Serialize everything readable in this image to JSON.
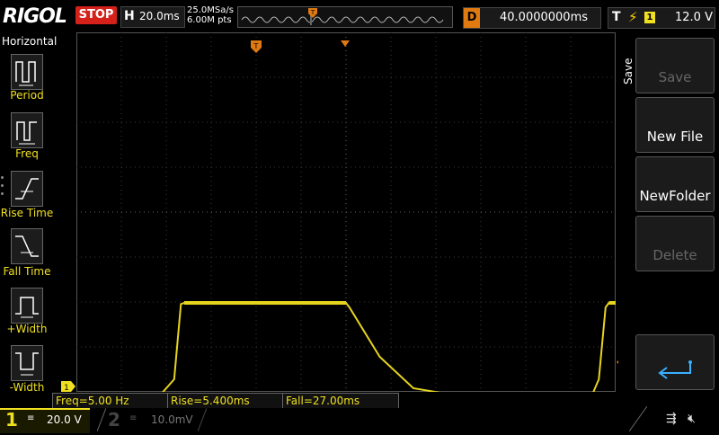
{
  "header": {
    "logo": "RIGOL",
    "run_state": "STOP",
    "timebase_label": "H",
    "timebase": "20.0ms",
    "sample_rate": "25.0MSa/s",
    "memory_depth": "6.00M pts",
    "delay_label": "D",
    "delay": "40.0000000ms",
    "trigger_label": "T",
    "trigger_source": "1",
    "trigger_level": "12.0 V"
  },
  "left_menu": {
    "title": "Horizontal",
    "items": [
      {
        "label": "Period",
        "icon": "period-icon"
      },
      {
        "label": "Freq",
        "icon": "frequency-icon"
      },
      {
        "label": "Rise Time",
        "icon": "rise-time-icon"
      },
      {
        "label": "Fall Time",
        "icon": "fall-time-icon"
      },
      {
        "label": "+Width",
        "icon": "positive-width-icon"
      },
      {
        "label": "-Width",
        "icon": "negative-width-icon"
      }
    ]
  },
  "right_menu": {
    "title": "Save",
    "buttons": [
      {
        "label": "Save",
        "enabled": false
      },
      {
        "label": "New File",
        "enabled": true
      },
      {
        "label": "NewFolder",
        "enabled": true
      },
      {
        "label": "Delete",
        "enabled": false
      },
      {
        "label": "",
        "icon": "return-arrow-icon",
        "enabled": true
      }
    ]
  },
  "measurements": [
    {
      "text": "Freq=5.00 Hz"
    },
    {
      "text": "Rise=5.400ms"
    },
    {
      "text": "Fall=27.00ms"
    }
  ],
  "channels": [
    {
      "number": "1",
      "coupling": "≡",
      "scale": "20.0 V",
      "active": true,
      "color": "#f0e020"
    },
    {
      "number": "2",
      "coupling": "≡",
      "scale": "10.0mV",
      "active": false,
      "color": "#444444"
    }
  ],
  "markers": {
    "trigger_position": "T",
    "channel_ground": "1"
  },
  "colors": {
    "trace": "#e6d41e",
    "grid": "#3a3a3a",
    "accent_orange": "#e07a10",
    "stop_red": "#d4221b"
  },
  "waveform": {
    "time_axis_ms": [
      -80,
      80
    ],
    "volts_per_div": 20,
    "description_points_volts": [
      {
        "t": -80,
        "v": -7.0
      },
      {
        "t": -70,
        "v": -6.5
      },
      {
        "t": -62,
        "v": -8.0
      },
      {
        "t": -55,
        "v": -6.8
      },
      {
        "t": -51,
        "v": 0
      },
      {
        "t": -49,
        "v": 33.5
      },
      {
        "t": -48,
        "v": 34.0
      },
      {
        "t": 0,
        "v": 34.0
      },
      {
        "t": 1,
        "v": 32.0
      },
      {
        "t": 10,
        "v": 10.0
      },
      {
        "t": 20,
        "v": -4.0
      },
      {
        "t": 28,
        "v": -6.0
      },
      {
        "t": 55,
        "v": -8.0
      },
      {
        "t": 73,
        "v": -7.0
      },
      {
        "t": 75,
        "v": 0
      },
      {
        "t": 77,
        "v": 32.0
      },
      {
        "t": 78,
        "v": 34.0
      },
      {
        "t": 80,
        "v": 34.0
      }
    ]
  }
}
